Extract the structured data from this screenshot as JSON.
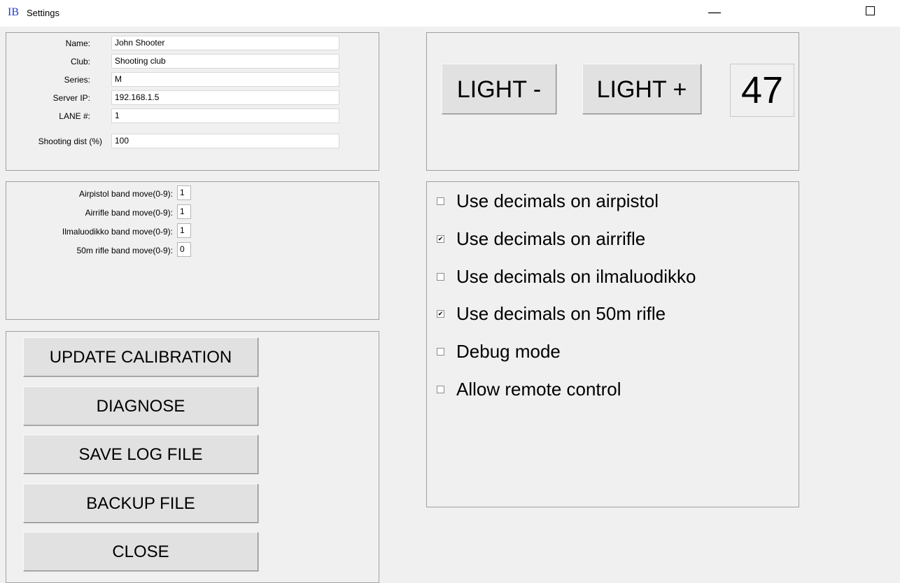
{
  "window": {
    "icon_text": "IB",
    "title": "Settings",
    "minimize_glyph": "—",
    "icons": {
      "app": "app-logo-icon",
      "minimize": "minimize-icon",
      "maximize": "maximize-icon"
    }
  },
  "info_form": {
    "fields": [
      {
        "label": "Name:",
        "value": "John Shooter"
      },
      {
        "label": "Club:",
        "value": "Shooting club"
      },
      {
        "label": "Series:",
        "value": "M"
      },
      {
        "label": "Server IP:",
        "value": "192.168.1.5"
      },
      {
        "label": "LANE #:",
        "value": "1"
      },
      {
        "label": "Shooting dist (%)",
        "value": "100"
      }
    ]
  },
  "band_form": {
    "fields": [
      {
        "label": "Airpistol band move(0-9):",
        "value": "1"
      },
      {
        "label": "Airrifle band move(0-9):",
        "value": "1"
      },
      {
        "label": "Ilmaluodikko band move(0-9):",
        "value": "1"
      },
      {
        "label": "50m rifle band move(0-9):",
        "value": "0"
      }
    ]
  },
  "actions": {
    "buttons": [
      {
        "label": "UPDATE CALIBRATION"
      },
      {
        "label": "DIAGNOSE"
      },
      {
        "label": "SAVE LOG FILE"
      },
      {
        "label": "BACKUP FILE"
      },
      {
        "label": "CLOSE"
      }
    ]
  },
  "light": {
    "minus_label": "LIGHT -",
    "plus_label": "LIGHT +",
    "value": "47"
  },
  "options": {
    "checkmark_glyph": "✔",
    "items": [
      {
        "label": "Use decimals on airpistol",
        "checked": false
      },
      {
        "label": "Use decimals on airrifle",
        "checked": true
      },
      {
        "label": "Use decimals on ilmaluodikko",
        "checked": false
      },
      {
        "label": "Use decimals on 50m rifle",
        "checked": true
      },
      {
        "label": "Debug mode",
        "checked": false
      },
      {
        "label": "Allow remote control",
        "checked": false
      }
    ]
  },
  "colors": {
    "window_background": "#f0f0f0",
    "titlebar_background": "#ffffff",
    "app_icon": "#1f3bd6",
    "panel_border": "#a0a0a0",
    "button_face": "#e1e1e1"
  }
}
